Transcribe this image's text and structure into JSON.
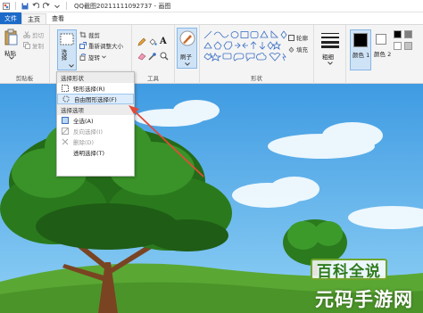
{
  "window": {
    "title": "QQ截图20211111092737 - 画图"
  },
  "tabs": {
    "file": "文件",
    "home": "主页",
    "view": "查看"
  },
  "clipboard": {
    "paste": "粘贴",
    "cut": "剪切",
    "copy": "复制",
    "group_label": "剪贴板"
  },
  "image": {
    "select": "选择",
    "crop": "裁剪",
    "resize": "重新调整大小",
    "rotate": "旋转"
  },
  "tools": {
    "group_label": "工具",
    "text_tool": "A"
  },
  "brushes": {
    "label": "刷子"
  },
  "shapes": {
    "outline": "轮廓",
    "fill": "填充",
    "group_label": "形状"
  },
  "size": {
    "label": "粗细"
  },
  "colors": {
    "color1": "颜色 1",
    "color2": "颜色 2",
    "color1_value": "#000000",
    "color2_value": "#ffffff"
  },
  "selection_menu": {
    "shapes_header": "选择形状",
    "rect_select": "矩形选择(R)",
    "freeform_select": "自由图形选择(F)",
    "options_header": "选择选项",
    "select_all": "全选(A)",
    "invert_select": "反向选择(I)",
    "delete": "删除(D)",
    "transparent_select": "透明选择(T)"
  },
  "watermark": {
    "line1": "百科全说",
    "line2": "元码手游网"
  },
  "accent": {
    "file_tab": "#1b6ac9",
    "arrow": "#e04b3a",
    "sky": "#4aa6e6"
  }
}
